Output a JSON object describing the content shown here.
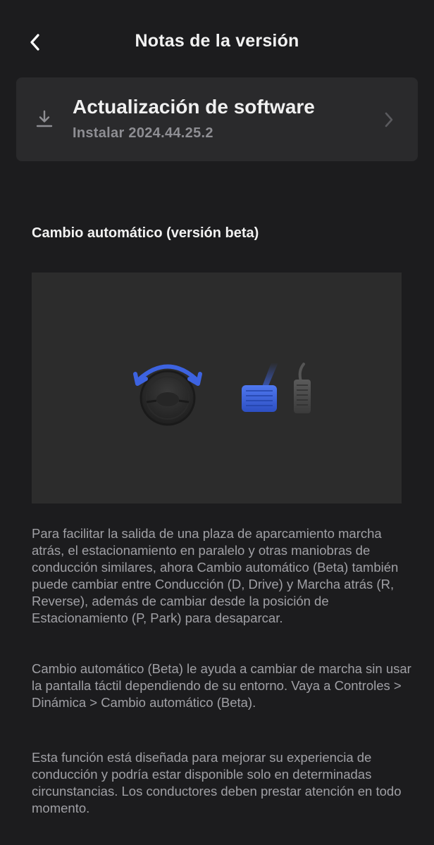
{
  "header": {
    "title": "Notas de la versión",
    "back_icon": "chevron-left-icon"
  },
  "update_card": {
    "icon": "download-icon",
    "title": "Actualización de software",
    "subtitle": "Instalar 2024.44.25.2",
    "chevron_icon": "chevron-right-icon"
  },
  "release_note": {
    "title": "Cambio automático (versión beta)",
    "image": {
      "icons": [
        "steering-wheel-icon",
        "rotation-arrow-icon",
        "brake-pedal-icon",
        "accelerator-pedal-icon"
      ],
      "accent_color": "#3d63e0"
    },
    "paragraphs": [
      "Para facilitar la salida de una plaza de aparcamiento marcha atrás, el estacionamiento en paralelo y otras maniobras de conducción similares, ahora Cambio automático (Beta) también puede cambiar entre Conducción (D, Drive) y Marcha atrás (R, Reverse), además de cambiar desde la posición de Estacionamiento (P, Park) para desaparcar.",
      "Cambio automático (Beta) le ayuda a cambiar de marcha sin usar la pantalla táctil dependiendo de su entorno. Vaya a Controles > Dinámica > Cambio automático (Beta).",
      "Esta función está diseñada para mejorar su experiencia de conducción y podría estar disponible solo en determinadas circunstancias. Los conductores deben prestar atención en todo momento."
    ]
  },
  "colors": {
    "background": "#1c1c1e",
    "card": "#2a2a2c",
    "text_primary": "#f2f2f2",
    "text_secondary": "#a0a0a5",
    "accent": "#3d63e0"
  }
}
